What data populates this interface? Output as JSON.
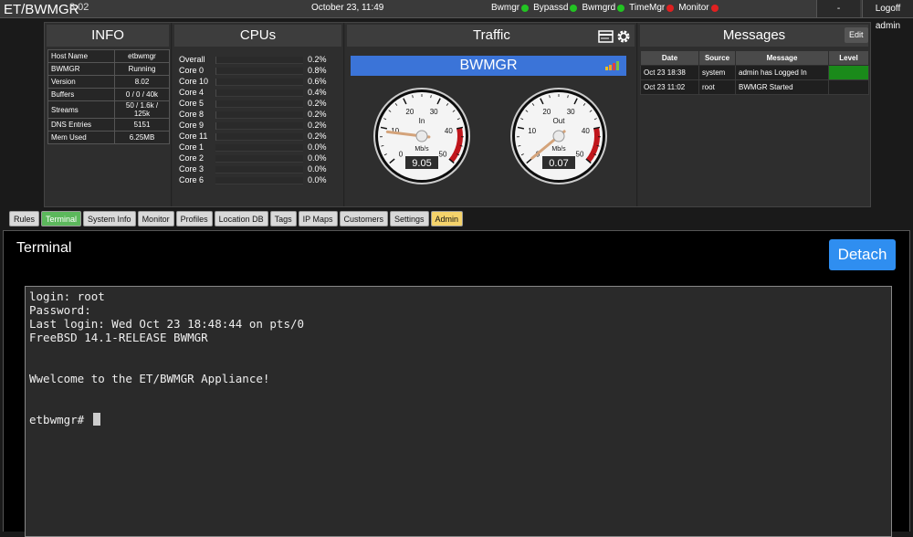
{
  "header": {
    "title": "ET/BWMGR",
    "version": "8.02",
    "datetime": "October 23, 11:49",
    "services": [
      {
        "name": "Bwmgr",
        "color": "#22c422"
      },
      {
        "name": "Bypassd",
        "color": "#22c422"
      },
      {
        "name": "Bwmgrd",
        "color": "#22c422"
      },
      {
        "name": "TimeMgr",
        "color": "#e02020"
      },
      {
        "name": "Monitor",
        "color": "#e02020"
      }
    ],
    "dash_label": "-",
    "logoff_label": "Logoff admin"
  },
  "info": {
    "title": "INFO",
    "rows": [
      {
        "k": "Host Name",
        "v": "etbwmgr"
      },
      {
        "k": "BWMGR",
        "v": "Running"
      },
      {
        "k": "Version",
        "v": "8.02"
      },
      {
        "k": "Buffers",
        "v": "0 / 0 / 40k"
      },
      {
        "k": "Streams",
        "v": "50 / 1.6k / 125k"
      },
      {
        "k": "DNS Entries",
        "v": "5151"
      },
      {
        "k": "Mem Used",
        "v": "6.25MB"
      }
    ]
  },
  "cpus": {
    "title": "CPUs",
    "rows": [
      {
        "name": "Overall",
        "value": "0.2%",
        "pct": 0.2
      },
      {
        "name": "Core 0",
        "value": "0.8%",
        "pct": 0.8
      },
      {
        "name": "Core 10",
        "value": "0.6%",
        "pct": 0.6
      },
      {
        "name": "Core 4",
        "value": "0.4%",
        "pct": 0.4
      },
      {
        "name": "Core 5",
        "value": "0.2%",
        "pct": 0.2
      },
      {
        "name": "Core 8",
        "value": "0.2%",
        "pct": 0.2
      },
      {
        "name": "Core 9",
        "value": "0.2%",
        "pct": 0.2
      },
      {
        "name": "Core 11",
        "value": "0.2%",
        "pct": 0.2
      },
      {
        "name": "Core 1",
        "value": "0.0%",
        "pct": 0.0
      },
      {
        "name": "Core 2",
        "value": "0.0%",
        "pct": 0.0
      },
      {
        "name": "Core 3",
        "value": "0.0%",
        "pct": 0.0
      },
      {
        "name": "Core 6",
        "value": "0.0%",
        "pct": 0.0
      }
    ]
  },
  "traffic": {
    "title": "Traffic",
    "device": "BWMGR",
    "unit": "Mb/s",
    "ticks": [
      "0",
      "10",
      "20",
      "30",
      "40",
      "50"
    ],
    "gauge_max": 50,
    "gauges": [
      {
        "label": "In",
        "value": "9.05",
        "num": 9.05
      },
      {
        "label": "Out",
        "value": "0.07",
        "num": 0.07
      }
    ],
    "accent": "#3b74d8"
  },
  "messages": {
    "title": "Messages",
    "edit_label": "Edit",
    "columns": [
      "Date",
      "Source",
      "Message",
      "Level"
    ],
    "rows": [
      {
        "date": "Oct 23 18:38",
        "source": "system",
        "message": "admin has Logged In",
        "level_color": "#1a8a1a"
      },
      {
        "date": "Oct 23 11:02",
        "source": "root",
        "message": "BWMGR Started",
        "level_color": "#1f1f1f"
      }
    ]
  },
  "tabs": [
    {
      "label": "Rules"
    },
    {
      "label": "Terminal",
      "active": true
    },
    {
      "label": "System Info"
    },
    {
      "label": "Monitor"
    },
    {
      "label": "Profiles"
    },
    {
      "label": "Location DB"
    },
    {
      "label": "Tags"
    },
    {
      "label": "IP Maps"
    },
    {
      "label": "Customers"
    },
    {
      "label": "Settings"
    },
    {
      "label": "Admin",
      "admin": true
    }
  ],
  "terminal": {
    "title": "Terminal",
    "detach_label": "Detach",
    "lines": [
      "login: root",
      "Password:",
      "Last login: Wed Oct 23 18:48:44 on pts/0",
      "FreeBSD 14.1-RELEASE BWMGR",
      "",
      "",
      "Wwelcome to the ET/BWMGR Appliance!",
      "",
      "",
      "etbwmgr# "
    ]
  }
}
